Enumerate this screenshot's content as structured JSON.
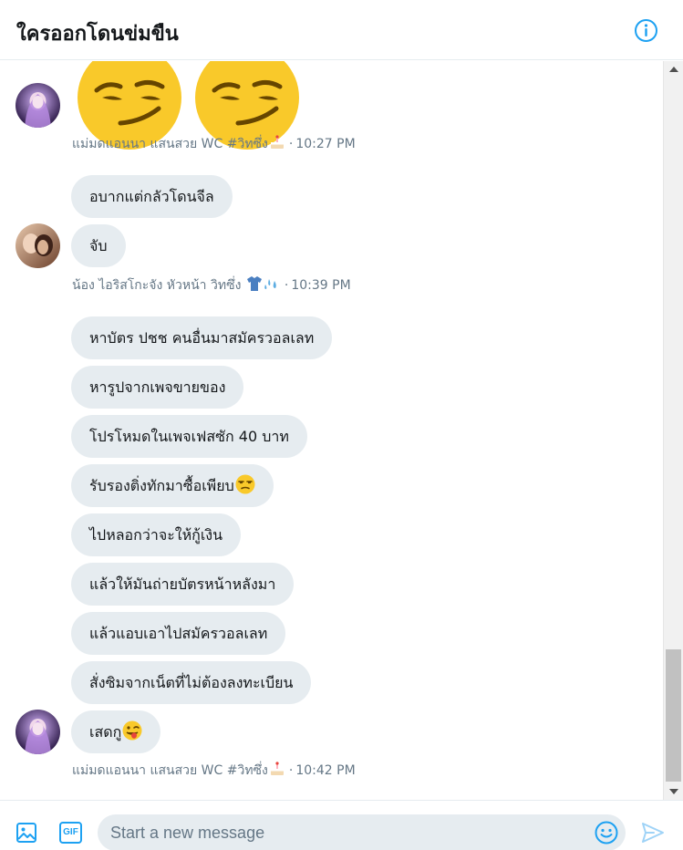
{
  "conversation": {
    "title": "ใครออกโดนข่มขืน"
  },
  "colors": {
    "accent": "#1da1f2",
    "bubble": "#e6ecf0",
    "meta_text": "#657786"
  },
  "groups": [
    {
      "sender": "แม่มดแอนนา แสนสวย WC #วิทซึ่ง",
      "sender_emoji": "cake",
      "time": "10:27 PM",
      "avatar": "purple-anime-avatar",
      "messages": [
        "(two smirking-face emoji)"
      ]
    },
    {
      "sender": "น้อง ไอริสโกะจัง หัวหน้า วิทซึ่ง",
      "sender_emoji": "shirt-and-droplets",
      "time": "10:39 PM",
      "avatar": "photo-avatar",
      "messages": [
        "อบากแต่กลัวโดนจีล",
        "จับ"
      ]
    },
    {
      "sender": "แม่มดแอนนา แสนสวย WC #วิทซึ่ง",
      "sender_emoji": "cake",
      "time": "10:42 PM",
      "avatar": "purple-anime-avatar",
      "messages": [
        "หาบัตร ปชช คนอื่นมาสมัครวอลเลท",
        "หารูปจากเพจขายของ",
        "โปรโหมดในเพจเฟสซัก 40 บาท",
        "รับรองติ่งทักมาซื้อเพียบ",
        "ไปหลอกว่าจะให้กู้เงิน",
        "แล้วให้มันถ่ายบัตรหน้าหลังมา",
        "แล้วแอบเอาไปสมัครวอลเลท",
        "สั่งซิมจากเน็ตที่ไม่ต้องลงทะเบียน",
        "เสดกู"
      ]
    }
  ],
  "composer": {
    "placeholder": "Start a new message",
    "gif_label": "GIF"
  },
  "meta_separator": "·"
}
